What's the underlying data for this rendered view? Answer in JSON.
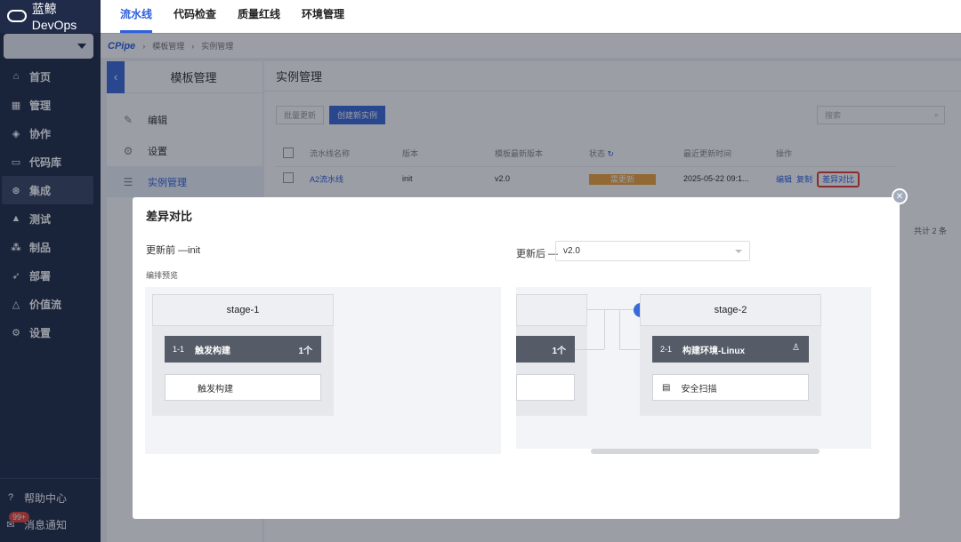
{
  "app": {
    "name": "蓝鲸DevOps"
  },
  "top_tabs": [
    "流水线",
    "代码检查",
    "质量红线",
    "环境管理"
  ],
  "breadcrumb": {
    "brand": "CPipe",
    "items": [
      "模板管理",
      "实例管理"
    ]
  },
  "sidebar": {
    "items": [
      "首页",
      "管理",
      "协作",
      "代码库",
      "集成",
      "测试",
      "制品",
      "部署",
      "价值流",
      "设置"
    ],
    "help": "帮助中心",
    "notify": "消息通知",
    "notify_badge": "99+"
  },
  "template_panel": {
    "title": "模板管理",
    "items": [
      "编辑",
      "设置",
      "实例管理"
    ]
  },
  "instance": {
    "title": "实例管理",
    "batch_update": "批量更新",
    "create_instance": "创建新实例",
    "search_placeholder": "搜索",
    "columns": [
      "流水线名称",
      "版本",
      "模板最新版本",
      "状态",
      "最近更新时间",
      "操作"
    ],
    "rows": [
      {
        "name": "A2流水线",
        "version": "init",
        "latest": "v2.0",
        "status": "需更新",
        "updated": "2025-05-22 09:1...",
        "actions": [
          "编辑",
          "复制",
          "差异对比"
        ]
      }
    ],
    "total": "共计 2 条"
  },
  "modal": {
    "title": "差异对比",
    "before_label": "更新前 —init",
    "preview_label": "编排预览",
    "after_label": "更新后 —",
    "after_version": "v2.0",
    "left": {
      "stage": "stage-1",
      "job_num": "1-1",
      "job_name": "触发构建",
      "job_count": "1个",
      "task": "触发构建"
    },
    "right": {
      "stage2": "stage-2",
      "job_count_partial": "1个",
      "job_num": "2-1",
      "job_name": "构建环境-Linux",
      "task": "安全扫描"
    }
  },
  "colors": {
    "primary": "#3a6ad9",
    "sidebar": "#1f2b48",
    "warning": "#f0a23e",
    "highlight": "#e53935"
  }
}
